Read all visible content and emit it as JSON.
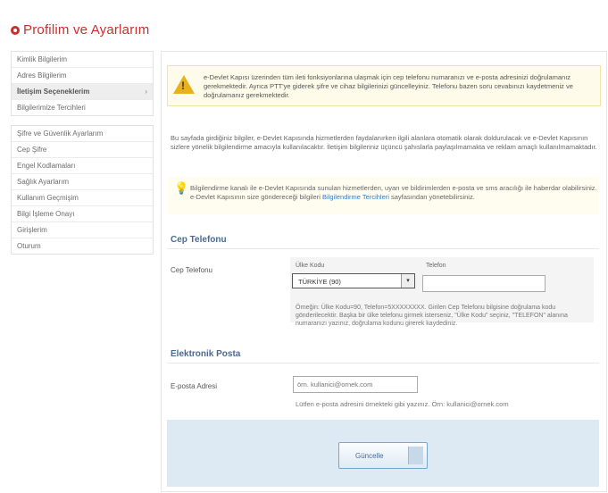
{
  "page": {
    "title": "Profilim ve Ayarlarım"
  },
  "sidebar": {
    "group1": [
      {
        "label": "Kimlik Bilgilerim"
      },
      {
        "label": "Adres Bilgilerim"
      },
      {
        "label": "İletişim Seçeneklerim",
        "active": true
      },
      {
        "label": "Bilgilerimize Tercihleri"
      }
    ],
    "group2": [
      {
        "label": "Şifre ve Güvenlik Ayarlarım"
      },
      {
        "label": "Cep Şifre"
      },
      {
        "label": "Engel Kodlamaları"
      },
      {
        "label": "Sağlık Ayarlarım"
      },
      {
        "label": "Kullanım Geçmişim"
      },
      {
        "label": "Bilgi İşleme Onayı"
      },
      {
        "label": "Girişlerim"
      },
      {
        "label": "Oturum"
      }
    ]
  },
  "warning": {
    "text": "e-Devlet Kapısı üzerinden tüm ileti fonksiyonlarına ulaşmak için cep telefonu numaranızı ve e-posta adresinizi doğrulamanız gerekmektedir. Ayrıca PTT'ye giderek şifre ve cihaz bilgilerinizi güncelleyiniz. Telefonu bazen soru cevabınızı kaydetmeniz ve doğrulamanız gerekmektedir."
  },
  "info": {
    "text": "Bu sayfada girdiğiniz bilgiler, e-Devlet Kapısında hizmetlerden faydalanırken ilgili alanlara otomatik olarak doldurulacak ve e-Devlet Kapısının sizlere yönelik bilgilendirme amacıyla kullanılacaktır. İletişim bilgileriniz üçüncü şahıslarla paylaşılmamakta ve reklam amaçlı kullanılmamaktadır."
  },
  "tip": {
    "text": "Bilgilendirme kanalı ile e-Devlet Kapısında sunulan hizmetlerden, uyarı ve bildirimlerden e-posta ve sms aracılığı ile haberdar olabilirsiniz. e-Devlet Kapısının size göndereceği bilgileri",
    "link": "Bilgilendirme Tercihleri",
    "suffix": "sayfasından yönetebilirsiniz."
  },
  "phone": {
    "section_title": "Cep Telefonu",
    "label": "Cep Telefonu",
    "country_code_label": "Ülke Kodu",
    "number_label": "Telefon",
    "country_selected": "TÜRKİYE (90)",
    "number_value": "",
    "help": "Örneğin: Ülke Kodu=90, Telefon=5XXXXXXXX. Girilen Cep Telefonu bilgisine doğrulama kodu gönderilecektir. Başka bir ülke telefonu girmek isterseniz, \"Ülke Kodu\" seçiniz, \"TELEFON\" alanına numaranızı yazınız, doğrulama kodunu girerek kaydediniz."
  },
  "email": {
    "section_title": "Elektronik Posta",
    "label": "E-posta Adresi",
    "placeholder": "örn. kullanici@ornek.com",
    "help": "Lütfen e-posta adresini örnekteki gibi yazınız.  Örn: kullanici@ornek.com"
  },
  "footer": {
    "save_label": "Güncelle"
  },
  "colors": {
    "accent": "#c8302c",
    "section": "#4a6b8f",
    "warning_bg": "#fffbea",
    "footer_bg": "#dde9f3"
  },
  "icons": {
    "warning": "warning-triangle-icon",
    "tip": "lightbulb-icon",
    "save": "save-icon"
  }
}
